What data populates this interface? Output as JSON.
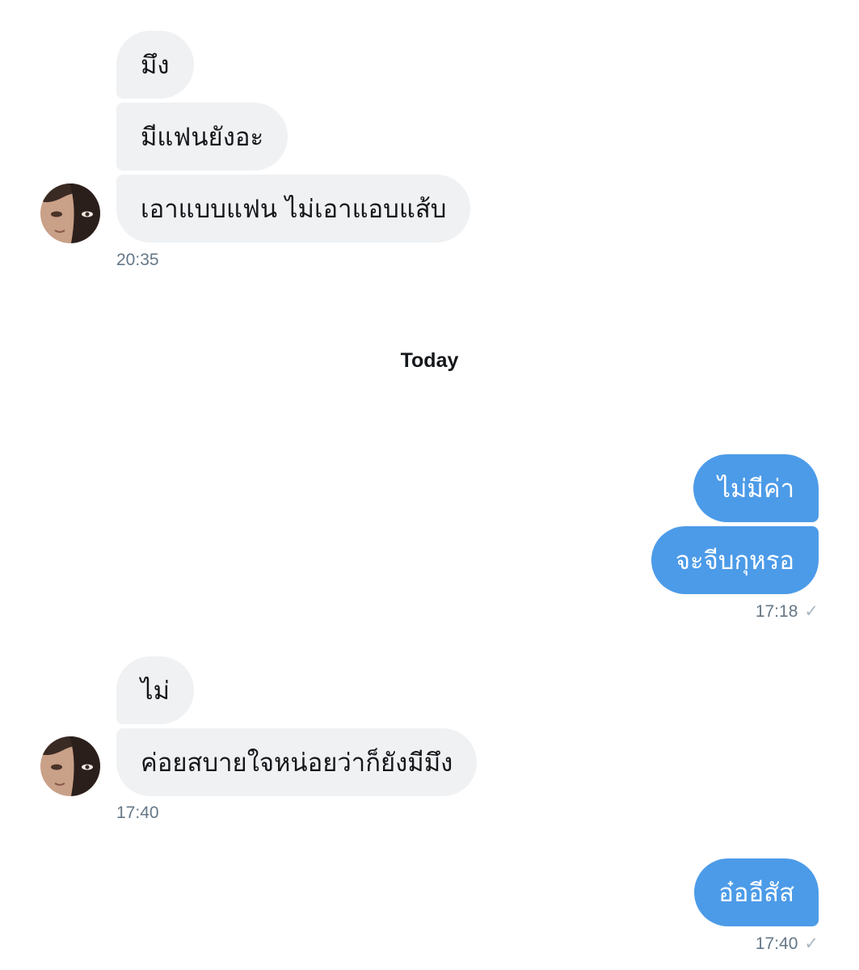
{
  "conversation": {
    "group1": {
      "messages": [
        "มึง",
        "มีแฟนยังอะ",
        "เอาแบบแฟน ไม่เอาแอบแส้บ"
      ],
      "time": "20:35"
    },
    "day_separator": "Today",
    "group2": {
      "messages": [
        "ไม่มีค่า",
        "จะจีบกุหรอ"
      ],
      "time": "17:18",
      "status_icon": "✓"
    },
    "group3": {
      "messages": [
        "ไม่",
        "ค่อยสบายใจหน่อยว่าก็ยังมีมึง"
      ],
      "time": "17:40"
    },
    "group4": {
      "messages": [
        "อ๋ออีสัส"
      ],
      "time": "17:40",
      "status_icon": "✓"
    }
  },
  "colors": {
    "incoming_bubble": "#eff1f3",
    "outgoing_bubble": "#4c9be8",
    "timestamp": "#657786"
  }
}
